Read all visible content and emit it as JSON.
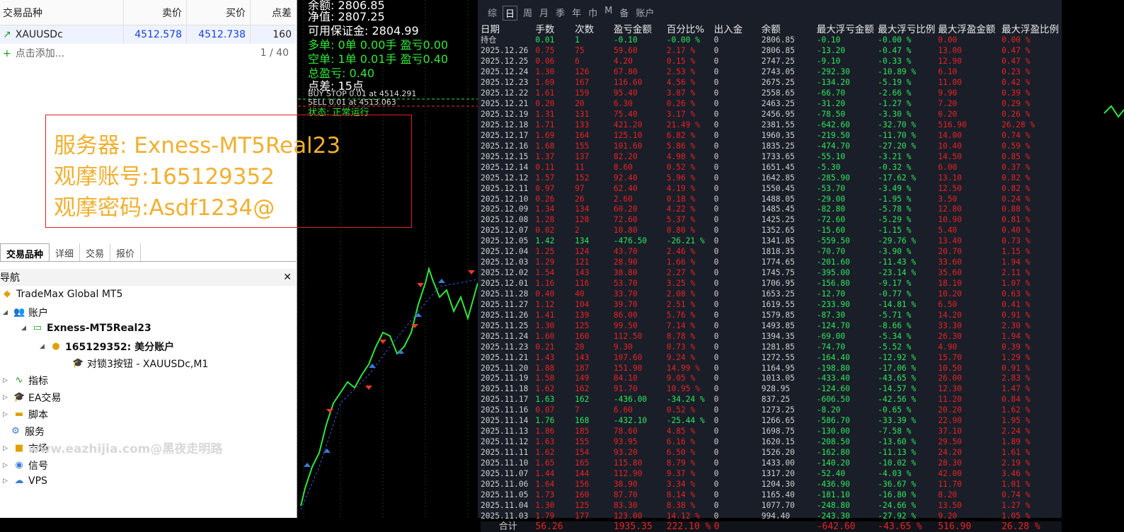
{
  "market_watch": {
    "headers": [
      "交易品种",
      "卖价",
      "买价",
      "点差"
    ],
    "symbol": "XAUUSDc",
    "bid": "4512.578",
    "ask": "4512.738",
    "spread": "160",
    "add_label": "点击添加...",
    "count": "1 / 40"
  },
  "overlay": {
    "server": "服务器: Exness-MT5Real23",
    "account": "观摩账号:165129352",
    "password": "观摩密码:Asdf1234@"
  },
  "tabs": [
    "交易品种",
    "详细",
    "交易",
    "报价"
  ],
  "navigator": {
    "title": "导航",
    "close": "✕",
    "broker": "TradeMax Global MT5",
    "accounts": "账户",
    "server": "Exness-MT5Real23",
    "account": "165129352: 美分账户",
    "ea": "对锁3按钮 - XAUUSDc,M1",
    "items": [
      "指标",
      "EA交易",
      "脚本",
      "服务",
      "市场",
      "信号",
      "VPS"
    ]
  },
  "watermark": "www.eazhijia.com@黑夜走明路",
  "chart_info": {
    "balance": "余额: 2806.85",
    "equity": "净值: 2807.25",
    "margin": "可用保证金: 2804.99",
    "long": "多单: 0单 0.00手 盈亏0.00",
    "short": "空单: 1单 0.01手 盈亏0.40",
    "total": "总盈亏: 0.40",
    "spread": "点差: 15点",
    "order1": "BUY STOP 0.01 at 4514.291",
    "order2": "SELL 0.01 at 4513.063",
    "status": "状态: 正常运行"
  },
  "colors": {
    "accent": "#f0b030",
    "panel_bg": "#1a1e28",
    "profit": "#e82323",
    "loss": "#2ee85c"
  },
  "panel": {
    "tabs": [
      "综",
      "日",
      "周",
      "月",
      "季",
      "年",
      "巾",
      "M",
      "备",
      "账户"
    ],
    "columns": [
      "日期",
      "手数",
      "次数",
      "盈亏金额",
      "百分比%",
      "出入金",
      "余额",
      "最大浮亏金额",
      "最大浮亏比例",
      "最大浮盈金额",
      "最大浮盈比例"
    ],
    "rows": [
      [
        "持仓",
        "0.01",
        "1",
        "-0.10",
        "-0.00 %",
        "0",
        "2806.85",
        "-0.10",
        "-0.00 %",
        "0.00",
        "0.00 %"
      ],
      [
        "2025.12.26",
        "0.75",
        "75",
        "59.60",
        "2.17 %",
        "0",
        "2806.85",
        "-13.20",
        "-0.47 %",
        "13.00",
        "0.47 %"
      ],
      [
        "2025.12.25",
        "0.06",
        "6",
        "4.20",
        "0.15 %",
        "0",
        "2747.25",
        "-9.10",
        "-0.33 %",
        "12.90",
        "0.47 %"
      ],
      [
        "2025.12.24",
        "1.30",
        "126",
        "67.80",
        "2.53 %",
        "0",
        "2743.05",
        "-292.30",
        "-10.89 %",
        "6.10",
        "0.23 %"
      ],
      [
        "2025.12.23",
        "1.69",
        "167",
        "116.60",
        "4.56 %",
        "0",
        "2675.25",
        "-134.20",
        "-5.19 %",
        "11.00",
        "0.42 %"
      ],
      [
        "2025.12.22",
        "1.61",
        "159",
        "95.40",
        "3.87 %",
        "0",
        "2558.65",
        "-66.70",
        "-2.66 %",
        "9.90",
        "0.39 %"
      ],
      [
        "2025.12.21",
        "0.20",
        "20",
        "6.30",
        "0.26 %",
        "0",
        "2463.25",
        "-31.20",
        "-1.27 %",
        "7.20",
        "0.29 %"
      ],
      [
        "2025.12.19",
        "1.31",
        "131",
        "75.40",
        "3.17 %",
        "0",
        "2456.95",
        "-78.50",
        "-3.30 %",
        "6.20",
        "0.26 %"
      ],
      [
        "2025.12.18",
        "1.71",
        "133",
        "421.20",
        "21.49 %",
        "0",
        "2381.55",
        "-642.60",
        "-32.70 %",
        "516.90",
        "26.28 %"
      ],
      [
        "2025.12.17",
        "1.69",
        "164",
        "125.10",
        "6.82 %",
        "0",
        "1960.35",
        "-219.50",
        "-11.70 %",
        "14.00",
        "0.74 %"
      ],
      [
        "2025.12.16",
        "1.68",
        "155",
        "101.60",
        "5.86 %",
        "0",
        "1835.25",
        "-474.70",
        "-27.20 %",
        "10.40",
        "0.59 %"
      ],
      [
        "2025.12.15",
        "1.37",
        "137",
        "82.20",
        "4.98 %",
        "0",
        "1733.65",
        "-55.10",
        "-3.21 %",
        "14.50",
        "0.85 %"
      ],
      [
        "2025.12.14",
        "0.11",
        "11",
        "8.60",
        "0.52 %",
        "0",
        "1651.45",
        "-5.30",
        "-0.32 %",
        "6.00",
        "0.37 %"
      ],
      [
        "2025.12.12",
        "1.57",
        "152",
        "92.40",
        "5.96 %",
        "0",
        "1642.85",
        "-285.90",
        "-17.62 %",
        "13.10",
        "0.82 %"
      ],
      [
        "2025.12.11",
        "0.97",
        "97",
        "62.40",
        "4.19 %",
        "0",
        "1550.45",
        "-53.70",
        "-3.49 %",
        "12.50",
        "0.82 %"
      ],
      [
        "2025.12.10",
        "0.26",
        "26",
        "2.60",
        "0.18 %",
        "0",
        "1488.05",
        "-29.00",
        "-1.95 %",
        "3.50",
        "0.24 %"
      ],
      [
        "2025.12.09",
        "1.34",
        "134",
        "60.20",
        "4.22 %",
        "0",
        "1485.45",
        "-82.80",
        "-5.78 %",
        "12.80",
        "0.88 %"
      ],
      [
        "2025.12.08",
        "1.28",
        "128",
        "72.60",
        "5.37 %",
        "0",
        "1425.25",
        "-72.60",
        "-5.29 %",
        "10.90",
        "0.81 %"
      ],
      [
        "2025.12.07",
        "0.02",
        "2",
        "10.80",
        "0.80 %",
        "0",
        "1352.65",
        "-15.60",
        "-1.15 %",
        "5.40",
        "0.40 %"
      ],
      [
        "2025.12.05",
        "1.42",
        "134",
        "-476.50",
        "-26.21 %",
        "0",
        "1341.85",
        "-559.50",
        "-29.76 %",
        "13.40",
        "0.73 %"
      ],
      [
        "2025.12.04",
        "1.25",
        "124",
        "43.70",
        "2.46 %",
        "0",
        "1818.35",
        "-70.70",
        "-3.90 %",
        "20.70",
        "1.15 %"
      ],
      [
        "2025.12.03",
        "1.29",
        "121",
        "28.90",
        "1.66 %",
        "0",
        "1774.65",
        "-201.60",
        "-11.43 %",
        "33.60",
        "1.94 %"
      ],
      [
        "2025.12.02",
        "1.54",
        "143",
        "38.80",
        "2.27 %",
        "0",
        "1745.75",
        "-395.00",
        "-23.14 %",
        "35.60",
        "2.11 %"
      ],
      [
        "2025.12.01",
        "1.16",
        "116",
        "53.70",
        "3.25 %",
        "0",
        "1706.95",
        "-156.80",
        "-9.17 %",
        "18.10",
        "1.07 %"
      ],
      [
        "2025.11.28",
        "0.40",
        "40",
        "33.70",
        "2.08 %",
        "0",
        "1653.25",
        "-12.70",
        "-0.77 %",
        "10.20",
        "0.63 %"
      ],
      [
        "2025.11.27",
        "1.12",
        "104",
        "39.70",
        "2.51 %",
        "0",
        "1619.55",
        "-233.90",
        "-14.81 %",
        "6.50",
        "0.41 %"
      ],
      [
        "2025.11.26",
        "1.41",
        "139",
        "86.00",
        "5.76 %",
        "0",
        "1579.85",
        "-87.30",
        "-5.71 %",
        "14.20",
        "0.91 %"
      ],
      [
        "2025.11.25",
        "1.30",
        "125",
        "99.50",
        "7.14 %",
        "0",
        "1493.85",
        "-124.70",
        "-8.66 %",
        "33.30",
        "2.30 %"
      ],
      [
        "2025.11.24",
        "1.60",
        "160",
        "112.50",
        "8.78 %",
        "0",
        "1394.35",
        "-69.00",
        "-5.34 %",
        "26.30",
        "1.94 %"
      ],
      [
        "2025.11.23",
        "0.21",
        "20",
        "9.30",
        "0.73 %",
        "0",
        "1281.85",
        "-74.70",
        "-5.52 %",
        "4.90",
        "0.39 %"
      ],
      [
        "2025.11.21",
        "1.43",
        "143",
        "107.60",
        "9.24 %",
        "0",
        "1272.55",
        "-164.40",
        "-12.92 %",
        "15.70",
        "1.29 %"
      ],
      [
        "2025.11.20",
        "1.88",
        "187",
        "151.90",
        "14.99 %",
        "0",
        "1164.95",
        "-198.80",
        "-17.06 %",
        "10.50",
        "0.91 %"
      ],
      [
        "2025.11.19",
        "1.58",
        "149",
        "84.10",
        "9.05 %",
        "0",
        "1013.05",
        "-433.40",
        "-43.65 %",
        "26.00",
        "2.83 %"
      ],
      [
        "2025.11.18",
        "1.62",
        "162",
        "91.70",
        "10.95 %",
        "0",
        "928.95",
        "-124.60",
        "-14.57 %",
        "12.30",
        "1.47 %"
      ],
      [
        "2025.11.17",
        "1.63",
        "162",
        "-436.00",
        "-34.24 %",
        "0",
        "837.25",
        "-606.50",
        "-42.56 %",
        "11.20",
        "0.84 %"
      ],
      [
        "2025.11.16",
        "0.07",
        "7",
        "6.60",
        "0.52 %",
        "0",
        "1273.25",
        "-8.20",
        "-0.65 %",
        "20.20",
        "1.62 %"
      ],
      [
        "2025.11.14",
        "1.76",
        "168",
        "-432.10",
        "-25.44 %",
        "0",
        "1266.65",
        "-586.70",
        "-33.39 %",
        "22.90",
        "1.95 %"
      ],
      [
        "2025.11.13",
        "1.86",
        "185",
        "78.60",
        "4.85 %",
        "0",
        "1698.75",
        "-130.00",
        "-7.58 %",
        "37.10",
        "2.24 %"
      ],
      [
        "2025.11.12",
        "1.63",
        "155",
        "93.95",
        "6.16 %",
        "0",
        "1620.15",
        "-208.50",
        "-13.60 %",
        "29.50",
        "1.89 %"
      ],
      [
        "2025.11.11",
        "1.62",
        "154",
        "93.20",
        "6.50 %",
        "0",
        "1526.20",
        "-162.80",
        "-11.13 %",
        "24.20",
        "1.61 %"
      ],
      [
        "2025.11.10",
        "1.65",
        "165",
        "115.80",
        "8.79 %",
        "0",
        "1433.00",
        "-140.20",
        "-10.02 %",
        "28.30",
        "2.19 %"
      ],
      [
        "2025.11.07",
        "1.44",
        "144",
        "112.90",
        "9.37 %",
        "0",
        "1317.20",
        "-52.40",
        "-4.03 %",
        "42.00",
        "3.46 %"
      ],
      [
        "2025.11.06",
        "1.64",
        "156",
        "38.90",
        "3.34 %",
        "0",
        "1204.30",
        "-436.90",
        "-36.67 %",
        "11.70",
        "1.01 %"
      ],
      [
        "2025.11.05",
        "1.73",
        "160",
        "87.70",
        "8.14 %",
        "0",
        "1165.40",
        "-181.10",
        "-16.80 %",
        "8.20",
        "0.74 %"
      ],
      [
        "2025.11.04",
        "1.30",
        "125",
        "83.30",
        "8.38 %",
        "0",
        "1077.70",
        "-248.80",
        "-24.66 %",
        "13.50",
        "1.27 %"
      ],
      [
        "2025.11.03",
        "1.79",
        "177",
        "123.00",
        "14.12 %",
        "0",
        "994.40",
        "-243.30",
        "-27.92 %",
        "9.20",
        "1.05 %"
      ]
    ],
    "total": [
      "合计",
      "56.26",
      "",
      "1935.35",
      "222.10 %",
      "0",
      "",
      "-642.60",
      "-43.65 %",
      "516.90",
      "26.28 %"
    ]
  }
}
